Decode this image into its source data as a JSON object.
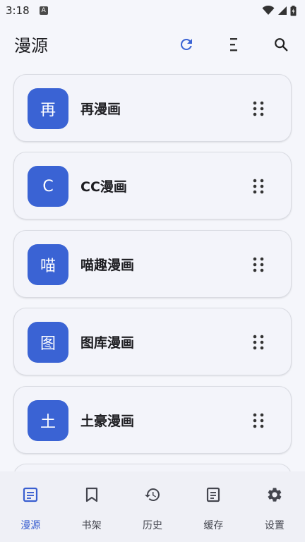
{
  "status_bar": {
    "time": "3:18",
    "notification_letter": "A"
  },
  "header": {
    "title": "漫源"
  },
  "sources": [
    {
      "avatar": "再",
      "name": "再漫画"
    },
    {
      "avatar": "C",
      "name": "CC漫画"
    },
    {
      "avatar": "喵",
      "name": "喵趣漫画"
    },
    {
      "avatar": "图",
      "name": "图库漫画"
    },
    {
      "avatar": "土",
      "name": "土豪漫画"
    }
  ],
  "bottom_nav": [
    {
      "label": "漫源",
      "icon": "article-icon",
      "active": true
    },
    {
      "label": "书架",
      "icon": "bookmark-icon",
      "active": false
    },
    {
      "label": "历史",
      "icon": "history-icon",
      "active": false
    },
    {
      "label": "缓存",
      "icon": "document-icon",
      "active": false
    },
    {
      "label": "设置",
      "icon": "gear-icon",
      "active": false
    }
  ],
  "colors": {
    "accent": "#3a63d4",
    "background": "#f5f6fb"
  }
}
